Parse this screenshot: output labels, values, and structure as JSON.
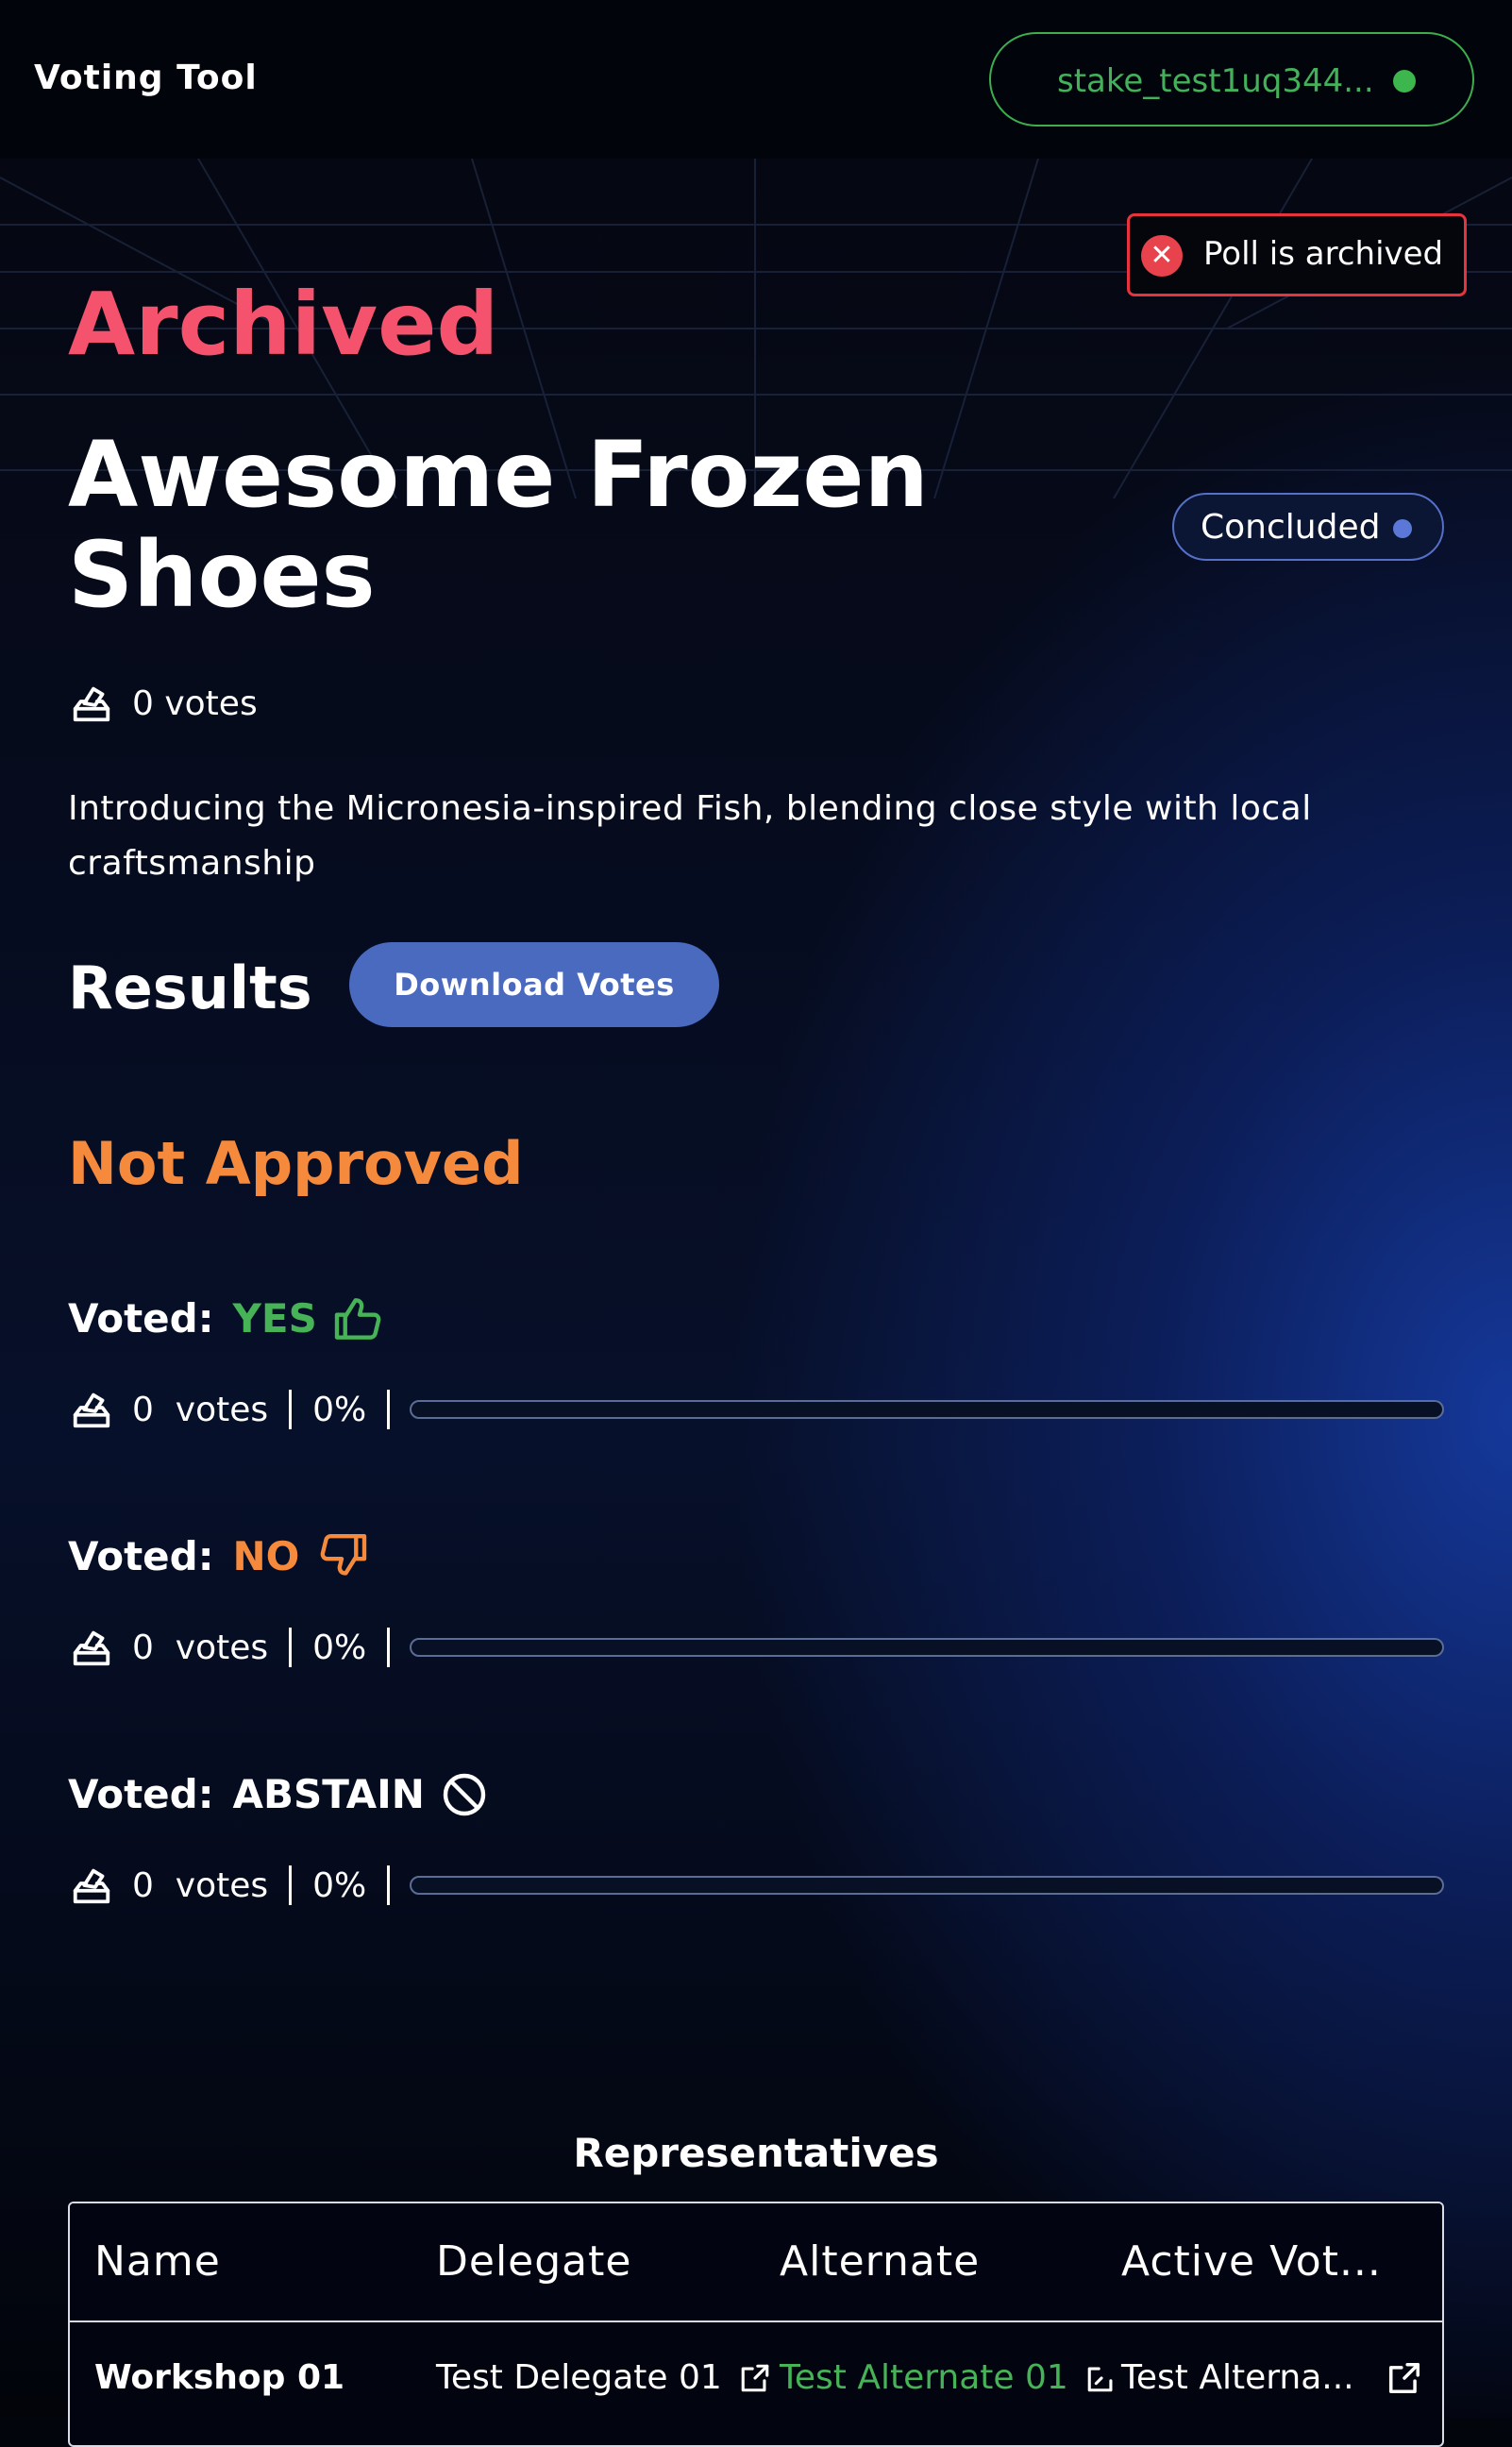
{
  "header": {
    "brand": "Voting Tool",
    "wallet_address": "stake_test1uq344...",
    "wallet_status_color": "#3cb64d"
  },
  "toast": {
    "icon": "close-circle-icon",
    "message": "Poll is archived",
    "border_color": "#e5343d"
  },
  "poll": {
    "status": "Archived",
    "title": "Awesome Frozen Shoes",
    "phase_badge": "Concluded",
    "votes_total": "0 votes",
    "description": "Introducing the Micronesia-inspired Fish, blending close style with local craftsmanship"
  },
  "results": {
    "heading": "Results",
    "download_label": "Download Votes",
    "outcome": "Not Approved",
    "options": [
      {
        "prefix": "Voted:",
        "choice": "YES",
        "choice_color": "#46b356",
        "icon": "thumbs-up-icon",
        "count": "0",
        "count_unit": "votes",
        "percent": "0%",
        "fraction": 0
      },
      {
        "prefix": "Voted:",
        "choice": "NO",
        "choice_color": "#f58a3c",
        "icon": "thumbs-down-icon",
        "count": "0",
        "count_unit": "votes",
        "percent": "0%",
        "fraction": 0
      },
      {
        "prefix": "Voted:",
        "choice": "ABSTAIN",
        "choice_color": "#ffffff",
        "icon": "prohibited-icon",
        "count": "0",
        "count_unit": "votes",
        "percent": "0%",
        "fraction": 0
      }
    ]
  },
  "representatives": {
    "title": "Representatives",
    "columns": [
      "Name",
      "Delegate",
      "Alternate",
      "Active Vot..."
    ],
    "rows": [
      {
        "name": "Workshop 01",
        "delegate": "Test Delegate 01",
        "alternate": "Test Alternate 01",
        "active_voter": "Test Alterna..."
      }
    ],
    "alternate_color": "#46b356"
  }
}
